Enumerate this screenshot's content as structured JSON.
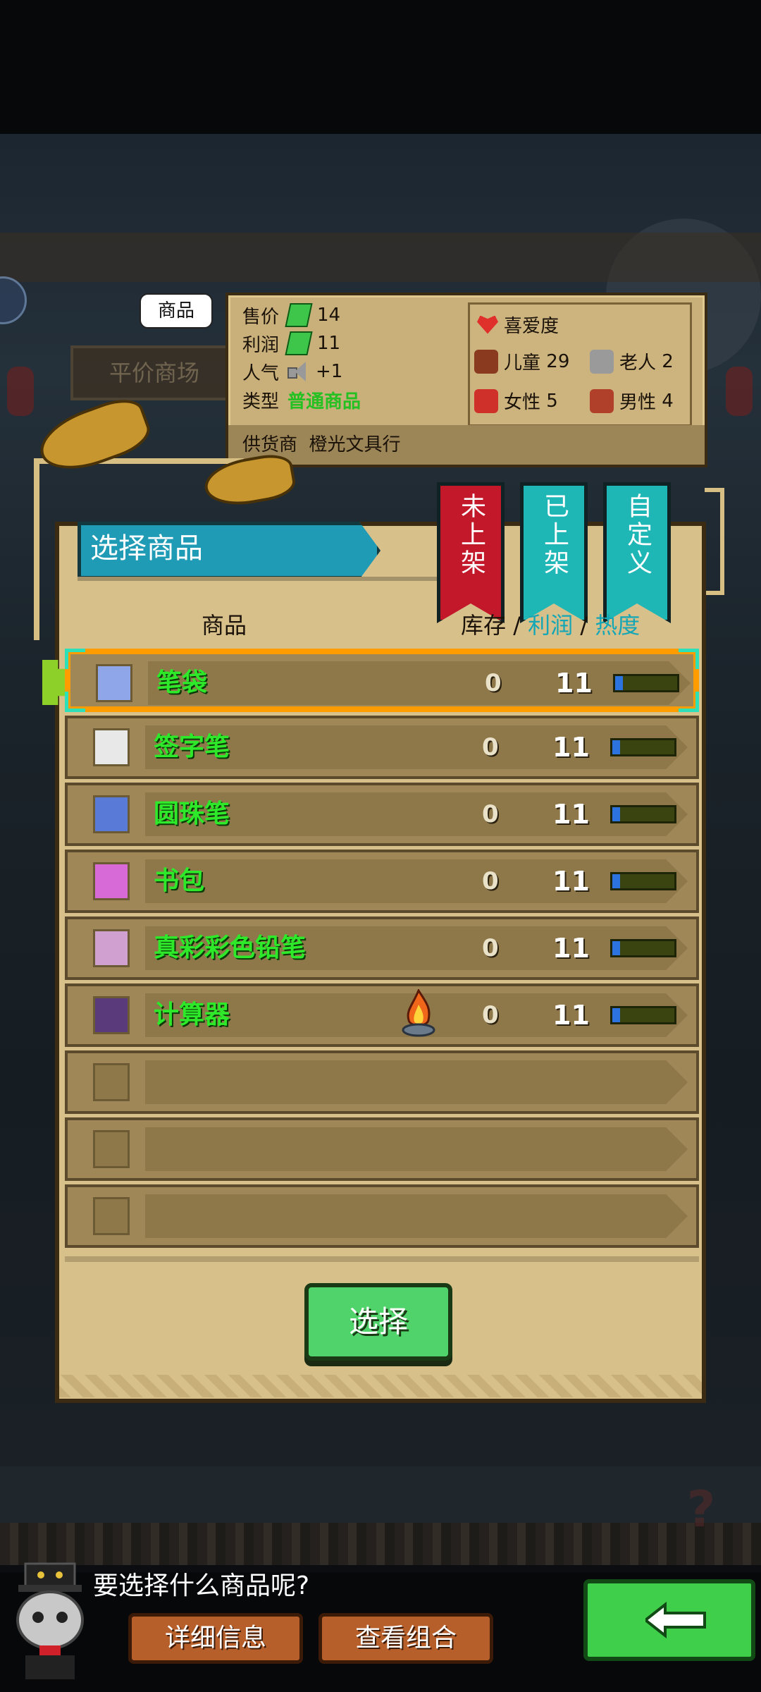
{
  "background": {
    "sign_text": "平价商场"
  },
  "tooltip": {
    "tag": "商品",
    "price_label": "售价",
    "price_value": "14",
    "profit_label": "利润",
    "profit_value": "11",
    "popularity_label": "人气",
    "popularity_value": "+1",
    "type_label": "类型",
    "type_value": "普通商品",
    "supplier_label": "供货商",
    "supplier_value": "橙光文具行",
    "favorability": {
      "title": "喜爱度",
      "children_label": "儿童",
      "children_value": "29",
      "elderly_label": "老人",
      "elderly_value": "2",
      "female_label": "女性",
      "female_value": "5",
      "male_label": "男性",
      "male_value": "4"
    }
  },
  "panel": {
    "title": "选择商品",
    "tabs": [
      "未上架",
      "已上架",
      "自定义"
    ],
    "col_goods": "商品",
    "col_stock": "库存",
    "col_profit": "利润",
    "col_heat": "热度",
    "separator": "/",
    "select_button": "选择"
  },
  "items": [
    {
      "name": "笔袋",
      "stock": "0",
      "profit": "11",
      "heat": 0.12,
      "icon": "pencil-case-icon",
      "selected": true
    },
    {
      "name": "签字笔",
      "stock": "0",
      "profit": "11",
      "heat": 0.12,
      "icon": "gel-pen-icon"
    },
    {
      "name": "圆珠笔",
      "stock": "0",
      "profit": "11",
      "heat": 0.12,
      "icon": "ballpoint-pen-icon"
    },
    {
      "name": "书包",
      "stock": "0",
      "profit": "11",
      "heat": 0.12,
      "icon": "school-bag-icon"
    },
    {
      "name": "真彩彩色铅笔",
      "stock": "0",
      "profit": "11",
      "heat": 0.12,
      "icon": "colored-pencils-icon"
    },
    {
      "name": "计算器",
      "stock": "0",
      "profit": "11",
      "heat": 0.12,
      "icon": "calculator-icon",
      "hot": true
    }
  ],
  "dialog": {
    "question": "要选择什么商品呢?",
    "details_button": "详细信息",
    "combo_button": "查看组合"
  },
  "colors": {
    "accent_green": "#2ee82a",
    "selection_orange": "#ff9c00",
    "tab_red": "#c2182a",
    "tab_teal": "#1fb6b6",
    "panel_bg": "#d8c08b"
  }
}
